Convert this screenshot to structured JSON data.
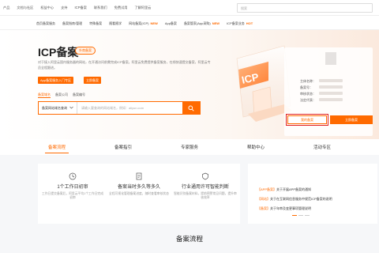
{
  "topbar": {
    "items": [
      "产品",
      "文档与社区",
      "权益中心",
      "支持",
      "ICP备案",
      "联系我们",
      "免费试用",
      "了解阿里云"
    ],
    "search_placeholder": "搜索"
  },
  "subnav": {
    "items": [
      "首页备案服务",
      "备案指南/管理",
      "特殊备案",
      "随看随学",
      "网站备案(ICP)",
      "App备案",
      "备案管家(App采购)",
      "ICP备案业务"
    ],
    "new_badge": "NEW",
    "hot_badge": "HOT"
  },
  "hero": {
    "title": "ICP备案",
    "badge": "外商备案",
    "desc": "对于接入阿里云国内服务器的网站，在开通访问前需完成ICP备案。阿里云免费提供备案服务，在线快速提交备案，阿里云专员全程跟进。",
    "tag_buttons": [
      "App备案服务入门专区",
      "立即备案"
    ],
    "tabs": [
      "备案域名",
      "备案公司",
      "备案编号"
    ],
    "select": "备案网站域名查询",
    "search_placeholder": "请输入要查询的网站域名，例如：aliyun.com"
  },
  "card": {
    "labels": [
      "主体名称：",
      "备案号：",
      "审核状态：",
      "法定代表："
    ],
    "btn_secondary": "我的备案",
    "btn_primary": "立即备案"
  },
  "mainnav": {
    "items": [
      "备案流程",
      "备案指引",
      "专家服务",
      "帮助中心",
      "活动专区"
    ]
  },
  "features": [
    {
      "title": "1个工作日初审",
      "desc": "工作日提交备案后，阿里云平均1个工作日完成初审"
    },
    {
      "title": "备案当时多久等多久",
      "desc": "全程可视化管理备案进度，随时查看审核状态"
    },
    {
      "title": "行业通用许可智能判断",
      "desc": "智能识别备案材料，提前预警常见问题，提升审核效率"
    }
  ],
  "news": [
    {
      "tag": "【APP备案】",
      "text": "关于开展APP备案的通知"
    },
    {
      "tag": "【网站】",
      "text": "关于在互联网信息服务中规范ICP备案的说明"
    },
    {
      "tag": "【备案】",
      "text": "关于年审及变更事项管理说明"
    }
  ],
  "section_title": "备案流程"
}
